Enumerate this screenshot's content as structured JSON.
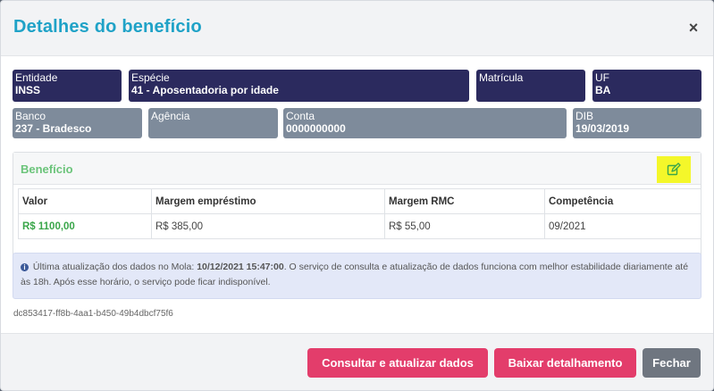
{
  "modal": {
    "title": "Detalhes do benefício",
    "close_label": "×"
  },
  "fields": {
    "entidade": {
      "label": "Entidade",
      "value": "INSS"
    },
    "especie": {
      "label": "Espécie",
      "value": "41 - Aposentadoria por idade"
    },
    "matricula": {
      "label": "Matrícula",
      "value": ""
    },
    "uf": {
      "label": "UF",
      "value": "BA"
    },
    "banco": {
      "label": "Banco",
      "value": "237 - Bradesco"
    },
    "agencia": {
      "label": "Agência",
      "value": ""
    },
    "conta": {
      "label": "Conta",
      "value": "0000000000"
    },
    "dib": {
      "label": "DIB",
      "value": "19/03/2019"
    }
  },
  "beneficio": {
    "title": "Benefício",
    "edit_icon": "edit-icon",
    "columns": [
      "Valor",
      "Margem empréstimo",
      "Margem RMC",
      "Competência"
    ],
    "row": [
      "R$ 1100,00",
      "R$ 385,00",
      "R$ 55,00",
      "09/2021"
    ]
  },
  "info": {
    "prefix": "Última atualização dos dados no Mola: ",
    "timestamp": "10/12/2021 15:47:00",
    "suffix": ". O serviço de consulta e atualização de dados funciona com melhor estabilidade diariamente até às 18h. Após esse horário, o serviço pode ficar indisponível."
  },
  "uuid": "dc853417-ff8b-4aa1-b450-49b4dbcf75f6",
  "buttons": {
    "consultar": "Consultar e atualizar dados",
    "baixar": "Baixar detalhamento",
    "fechar": "Fechar"
  },
  "colors": {
    "title": "#1fa2c7",
    "dark_field": "#2b2a5e",
    "gray_field": "#7e8b9b",
    "accent": "#e33d6b",
    "green": "#6bc47a",
    "highlight": "#f4f72a"
  }
}
